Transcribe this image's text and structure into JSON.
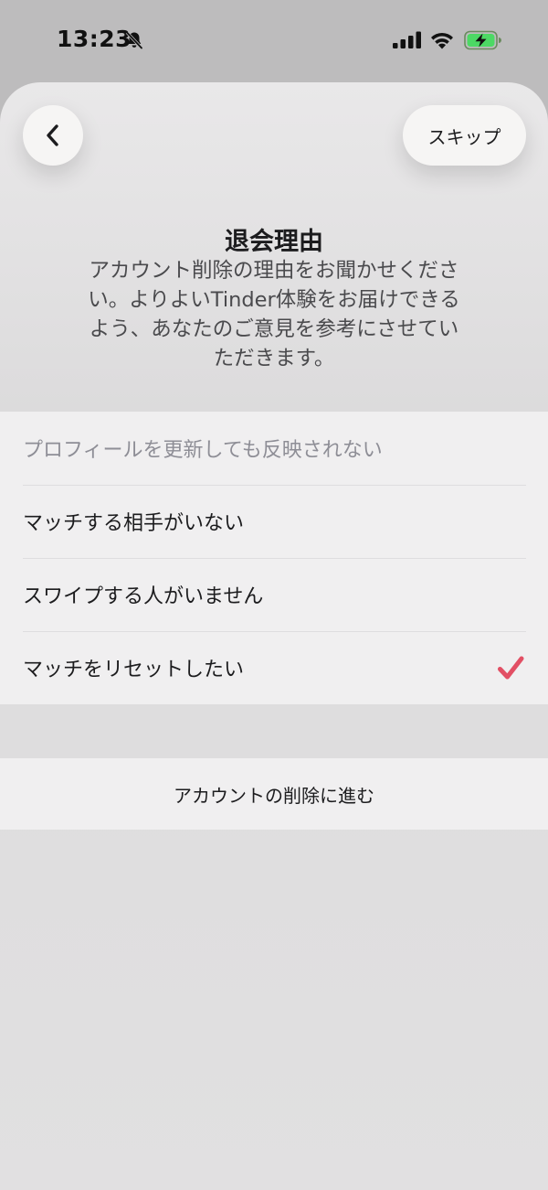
{
  "status_bar": {
    "time": "13:23",
    "icons": [
      "bell-off-icon",
      "signal-icon",
      "wifi-icon",
      "battery-charging-icon"
    ],
    "battery_color": "#4cd964"
  },
  "header": {
    "back_icon": "chevron-left-icon",
    "skip_label": "スキップ"
  },
  "content": {
    "title": "退会理由",
    "description_lines": [
      "アカウント削除の理由をお聞かせくださ",
      "い。よりよいTinder体験をお届けできる",
      "よう、あなたのご意見を参考にさせてい",
      "ただきます。"
    ]
  },
  "reasons": {
    "items": [
      {
        "label": "プロフィールを更新しても反映されない",
        "selected": false
      },
      {
        "label": "マッチする相手がいない",
        "selected": false
      },
      {
        "label": "スワイプする人がいません",
        "selected": false
      },
      {
        "label": "マッチをリセットしたい",
        "selected": true
      }
    ]
  },
  "footer": {
    "proceed_label": "アカウントの削除に進む"
  },
  "colors": {
    "accent_check": "#e24f64",
    "placeholder_text": "#8e8e96"
  }
}
